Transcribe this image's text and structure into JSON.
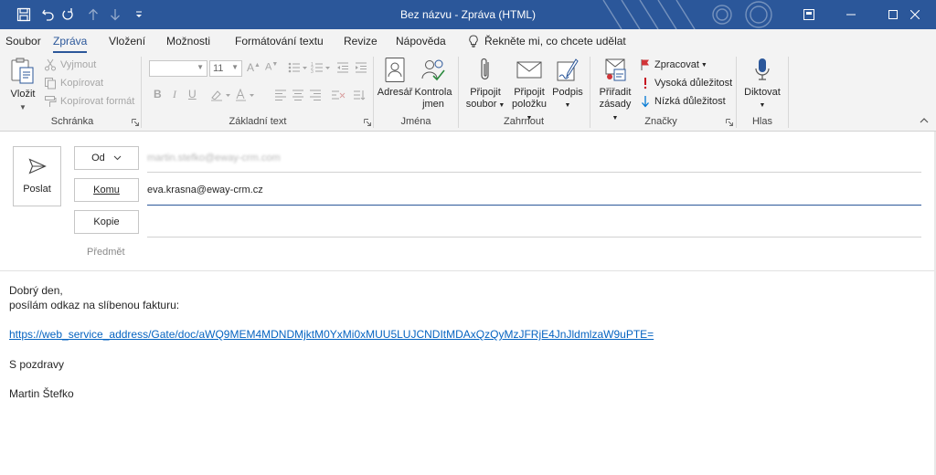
{
  "window": {
    "title": "Bez názvu  -  Zpráva (HTML)"
  },
  "menu": {
    "tabs": [
      "Soubor",
      "Zpráva",
      "Vložení",
      "Možnosti",
      "Formátování textu",
      "Revize",
      "Nápověda"
    ],
    "active_tab": "Zpráva",
    "tell_me": "Řekněte mi, co chcete udělat"
  },
  "ribbon": {
    "clipboard": {
      "label": "Schránka",
      "paste": "Vložit",
      "cut": "Vyjmout",
      "copy": "Kopírovat",
      "format_painter": "Kopírovat formát"
    },
    "basic_text": {
      "label": "Základní text",
      "font_size": "11"
    },
    "names": {
      "label": "Jména",
      "address_book": "Adresář",
      "check_names_1": "Kontrola",
      "check_names_2": "jmen"
    },
    "include": {
      "label": "Zahrnout",
      "attach_file_1": "Připojit",
      "attach_file_2": "soubor",
      "attach_item_1": "Připojit",
      "attach_item_2": "položku",
      "signature": "Podpis"
    },
    "tags": {
      "label": "Značky",
      "assign_policy_1": "Přiřadit",
      "assign_policy_2": "zásady",
      "follow_up": "Zpracovat",
      "high_importance": "Vysoká důležitost",
      "low_importance": "Nízká důležitost"
    },
    "voice": {
      "label": "Hlas",
      "dictate": "Diktovat"
    }
  },
  "compose": {
    "send": "Poslat",
    "from_button": "Od",
    "from_value": "martin.stefko@eway-crm.com",
    "to_button": "Komu",
    "to_value": "eva.krasna@eway-crm.cz",
    "cc_button": "Kopie",
    "subject_label": "Předmět"
  },
  "body": {
    "greeting": "Dobrý den,",
    "intro": "posílám odkaz na slíbenou fakturu:",
    "link": "https://web_service_address/Gate/doc/aWQ9MEM4MDNDMjktM0YxMi0xMUU5LUJCNDItMDAxQzQyMzJFRjE4JnJldmlzaW9uPTE=",
    "closing": "S pozdravy",
    "signature": "Martin Štefko"
  },
  "colors": {
    "accent": "#2b579a",
    "link": "#0563c1",
    "flag": "#d13438",
    "high_importance": "#c50f1f",
    "low_importance": "#0078d4"
  }
}
